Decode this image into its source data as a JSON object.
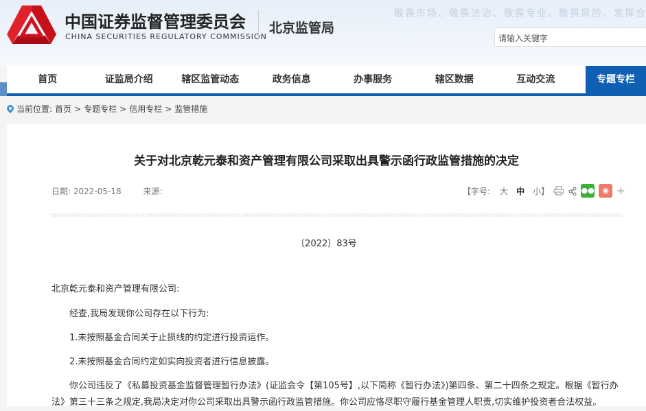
{
  "header": {
    "org_cn": "中国证券监督管理委员会",
    "org_en": "CHINA SECURITIES REGULATORY COMMISSION",
    "bureau": "北京监管局",
    "slogan": "敬畏市场、敬畏法治、敬畏专业、敬畏风险、发挥合",
    "search_placeholder": "请输入关键字",
    "brand_color": "#d0121b"
  },
  "nav": {
    "items": [
      "首页",
      "证监局介绍",
      "辖区监管动态",
      "政务信息",
      "办事服务",
      "辖区数据",
      "互动交流",
      "专题专栏"
    ],
    "active": "专题专栏",
    "accent": "#0f5fb3"
  },
  "breadcrumb": {
    "label": "当前位置:",
    "items": [
      "首页",
      "专题专栏",
      "信用专栏",
      "监管措施"
    ],
    "sep": ">"
  },
  "article": {
    "title": "关于对北京乾元泰和资产管理有限公司采取出具警示函行政监管措施的决定",
    "date_label": "日期:",
    "date": "2022-05-18",
    "source_label": "来源:",
    "font_label_open": "【字号:",
    "font_large": "大",
    "font_mid": "中",
    "font_small": "小】",
    "more": "+",
    "doc_no": "〔2022〕83号",
    "paragraphs": [
      "北京乾元泰和资产管理有限公司:",
      "经查,我局发现你公司存在以下行为:",
      "1.未按照基金合同关于止损线的约定进行投资运作。",
      "2.未按照基金合同约定如实向投资者进行信息披露。",
      "你公司违反了《私募投资基金监督管理暂行办法》(证监会令【第105号】,以下简称《暂行办法》)第四条、第二十四条之规定。根据《暂行办法》第三十三条之规定,我局决定对你公司采取出具警示函行政监管措施。你公司应恪尽职守履行基金管理人职责,切实维护投资者合法权益。"
    ]
  }
}
